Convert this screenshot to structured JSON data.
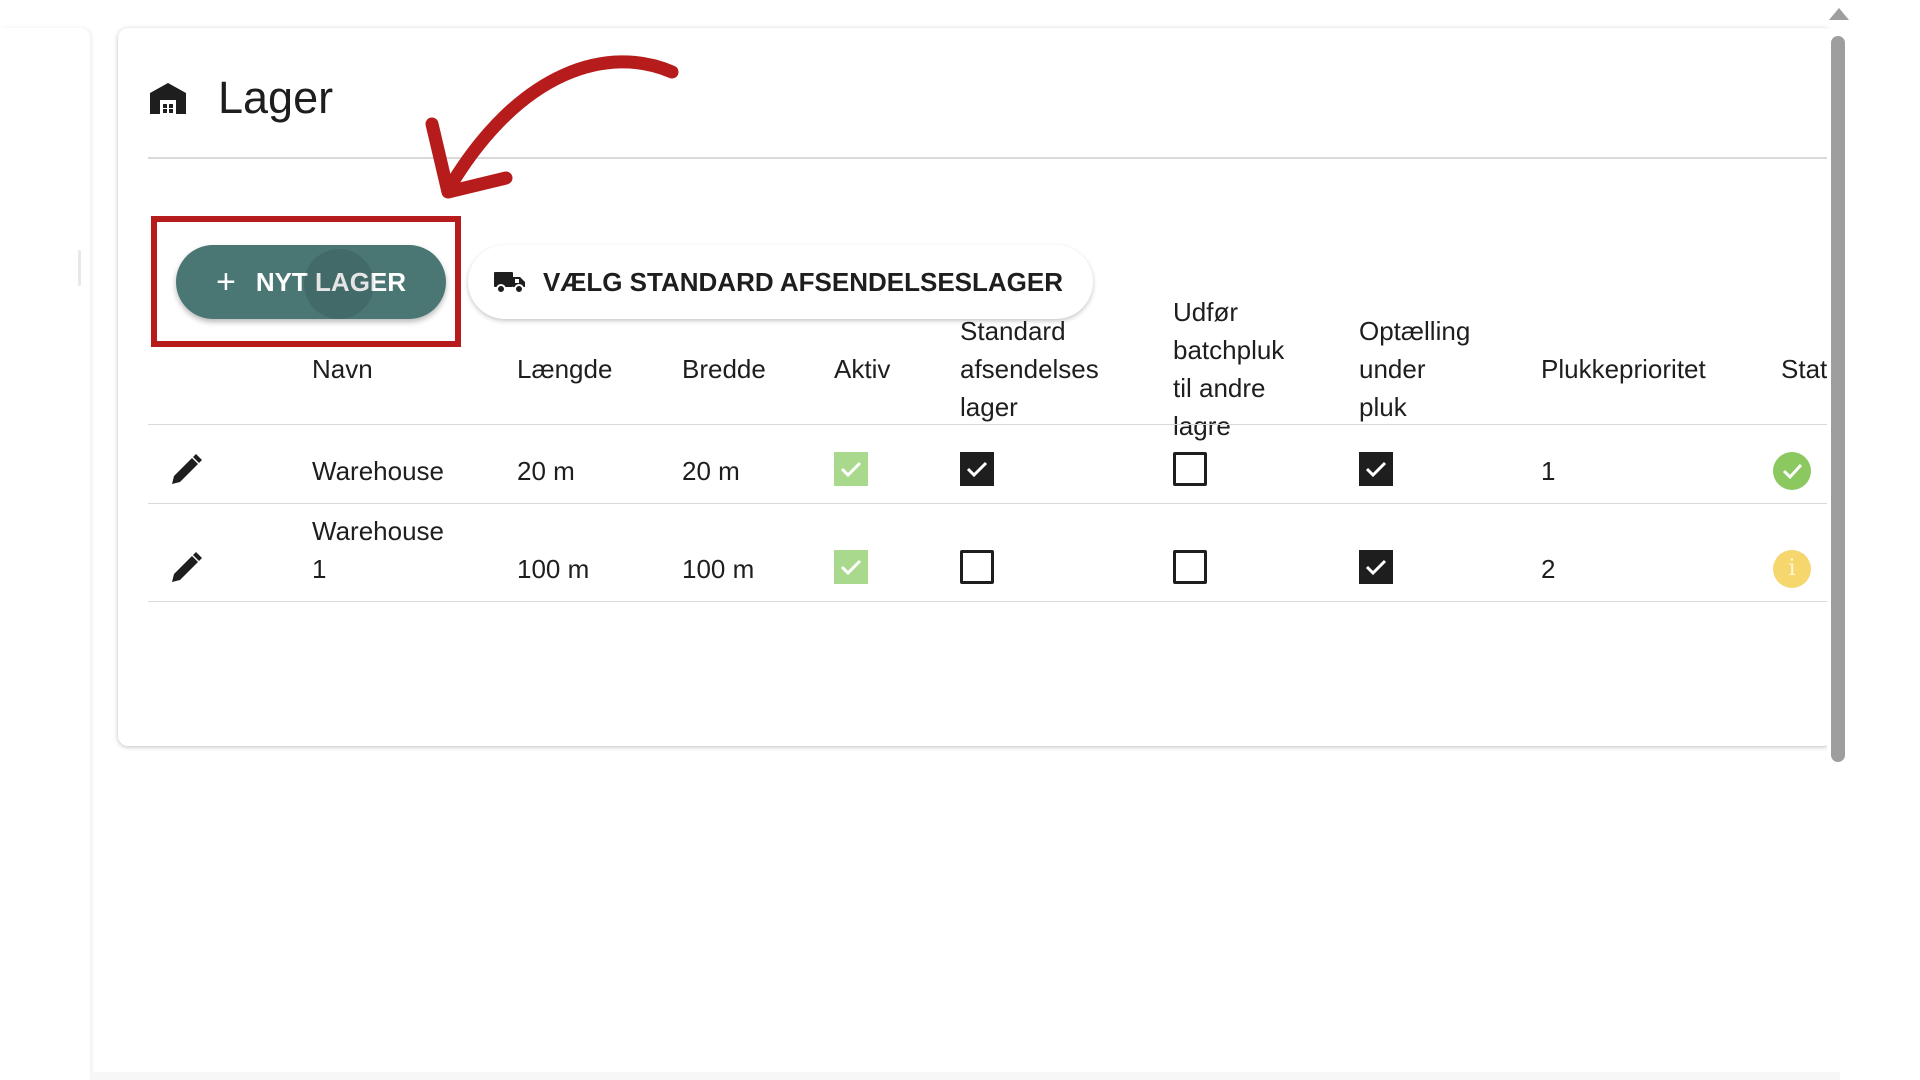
{
  "page": {
    "title": "Lager",
    "title_icon": "warehouse-icon"
  },
  "toolbar": {
    "new_label": "NYT LAGER",
    "new_icon": "plus-icon",
    "standard_label": "VÆLG STANDARD AFSENDELSESLAGER",
    "standard_icon": "truck-icon"
  },
  "table": {
    "headers": {
      "name": "Navn",
      "length": "Længde",
      "width": "Bredde",
      "active": "Aktiv",
      "standard": [
        "Standard",
        "afsendelses",
        "lager"
      ],
      "batch": [
        "Udfør",
        "batchpluk",
        "til andre",
        "lagre"
      ],
      "count": [
        "Optælling",
        "under",
        "pluk"
      ],
      "priority": "Plukkeprioritet",
      "status": "Statu"
    },
    "rows": [
      {
        "name": [
          "Warehouse"
        ],
        "length": "20 m",
        "width": "20 m",
        "active": true,
        "standard": true,
        "batch": false,
        "count": true,
        "priority": "1",
        "status": "ok"
      },
      {
        "name": [
          "Warehouse",
          "1"
        ],
        "length": "100 m",
        "width": "100 m",
        "active": true,
        "standard": false,
        "batch": false,
        "count": true,
        "priority": "2",
        "status": "warning"
      }
    ]
  },
  "colors": {
    "primary_button": "#4a7774",
    "highlight": "#b71c1c",
    "active_check": "#a8d98c",
    "status_ok": "#8bc860",
    "status_warning": "#f5d76e"
  }
}
